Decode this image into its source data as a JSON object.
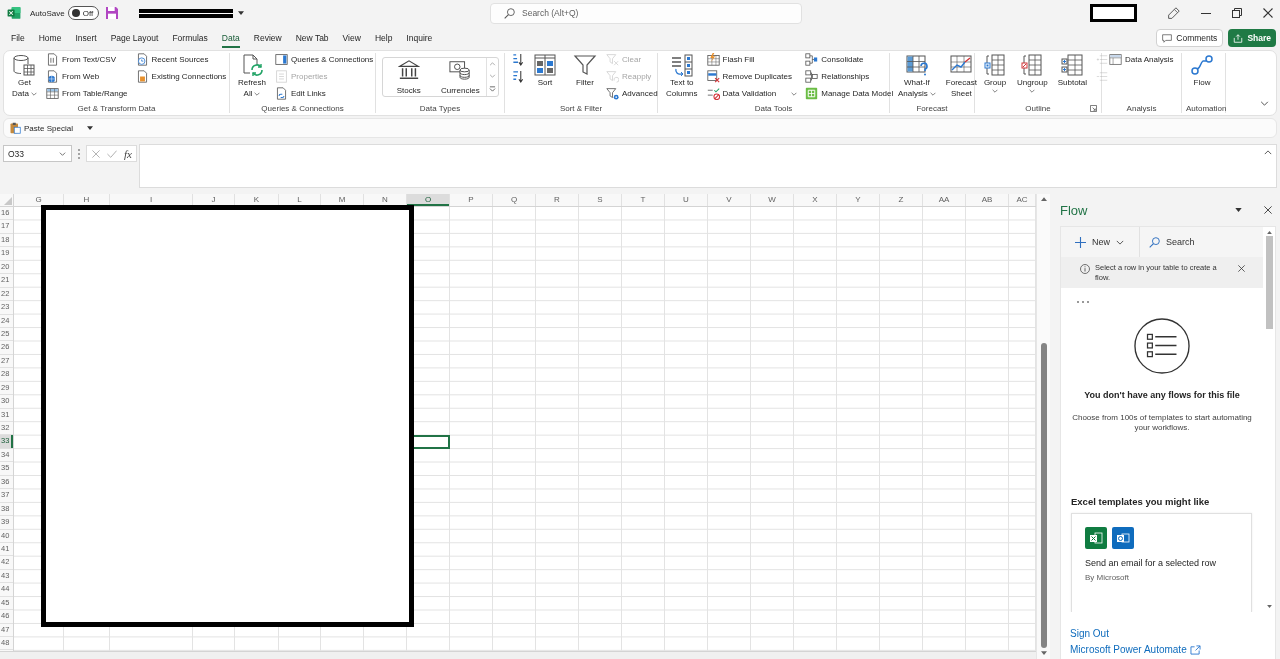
{
  "title_bar": {
    "autosave": {
      "label": "AutoSave",
      "on": false,
      "state": "Off"
    },
    "search": {
      "placeholder": "Search (Alt+Q)"
    }
  },
  "menu": {
    "tabs": [
      {
        "label": "File",
        "selected": false
      },
      {
        "label": "Home",
        "selected": false
      },
      {
        "label": "Insert",
        "selected": false
      },
      {
        "label": "Page Layout",
        "selected": false
      },
      {
        "label": "Formulas",
        "selected": false
      },
      {
        "label": "Data",
        "selected": true
      },
      {
        "label": "Review",
        "selected": false
      },
      {
        "label": "New Tab",
        "selected": false
      },
      {
        "label": "View",
        "selected": false
      },
      {
        "label": "Help",
        "selected": false
      },
      {
        "label": "Inquire",
        "selected": false
      }
    ],
    "buttons": [
      {
        "kind": "comments",
        "label": "Comments"
      },
      {
        "kind": "share",
        "label": "Share"
      }
    ]
  },
  "ribbon": {
    "groups": [
      {
        "label": "Get & Transform Data",
        "launcher": false,
        "controls": [
          {
            "kind": "large",
            "lines": [
              "Get",
              "Data"
            ],
            "dropdown": true,
            "disabled": false
          },
          {
            "kind": "small",
            "label": "From Text/CSV",
            "dropdown": false,
            "disabled": false
          },
          {
            "kind": "small",
            "label": "From Web",
            "dropdown": false,
            "disabled": false
          },
          {
            "kind": "small",
            "label": "From Table/Range",
            "dropdown": false,
            "disabled": false
          },
          {
            "kind": "small",
            "label": "Recent Sources",
            "dropdown": false,
            "disabled": false
          },
          {
            "kind": "small",
            "label": "Existing Connections",
            "dropdown": false,
            "disabled": false
          }
        ]
      },
      {
        "label": "Queries & Connections",
        "launcher": false,
        "controls": [
          {
            "kind": "large",
            "lines": [
              "Refresh",
              "All"
            ],
            "dropdown": true,
            "disabled": false
          },
          {
            "kind": "small",
            "label": "Queries & Connections",
            "dropdown": false,
            "disabled": false
          },
          {
            "kind": "small",
            "label": "Properties",
            "dropdown": false,
            "disabled": true
          },
          {
            "kind": "small",
            "label": "Edit Links",
            "dropdown": false,
            "disabled": false
          }
        ]
      },
      {
        "label": "Data Types",
        "launcher": false,
        "controls": [
          {
            "kind": "gallery",
            "options": [
              {
                "label": "Stocks"
              },
              {
                "label": "Currencies"
              }
            ],
            "dropdown": true,
            "disabled": false
          }
        ]
      },
      {
        "label": "Sort & Filter",
        "launcher": false,
        "controls": [
          {
            "kind": "icon",
            "dropdown": false,
            "disabled": false
          },
          {
            "kind": "icon",
            "dropdown": false,
            "disabled": false
          },
          {
            "kind": "large",
            "lines": [
              "Sort"
            ],
            "dropdown": false,
            "disabled": false
          },
          {
            "kind": "divider"
          },
          {
            "kind": "large",
            "lines": [
              "Filter"
            ],
            "dropdown": false,
            "disabled": false
          },
          {
            "kind": "small",
            "label": "Clear",
            "dropdown": false,
            "disabled": true
          },
          {
            "kind": "small",
            "label": "Reapply",
            "dropdown": false,
            "disabled": true
          },
          {
            "kind": "small",
            "label": "Advanced",
            "dropdown": false,
            "disabled": false
          }
        ]
      },
      {
        "label": "Data Tools",
        "launcher": false,
        "controls": [
          {
            "kind": "large",
            "lines": [
              "Text to",
              "Columns"
            ],
            "dropdown": false,
            "disabled": false
          },
          {
            "kind": "small",
            "label": "Flash Fill",
            "dropdown": false,
            "disabled": false
          },
          {
            "kind": "small",
            "label": "Remove Duplicates",
            "dropdown": false,
            "disabled": false
          },
          {
            "kind": "small",
            "label": "Data Validation",
            "dropdown": true,
            "disabled": false
          },
          {
            "kind": "small",
            "label": "Consolidate",
            "dropdown": false,
            "disabled": false
          },
          {
            "kind": "small",
            "label": "Relationships",
            "dropdown": false,
            "disabled": false
          },
          {
            "kind": "small",
            "label": "Manage Data Model",
            "dropdown": false,
            "disabled": false
          }
        ]
      },
      {
        "label": "Forecast",
        "launcher": false,
        "controls": [
          {
            "kind": "large",
            "lines": [
              "What-If",
              "Analysis"
            ],
            "dropdown": true,
            "disabled": false
          },
          {
            "kind": "large",
            "lines": [
              "Forecast",
              "Sheet"
            ],
            "dropdown": false,
            "disabled": false
          }
        ]
      },
      {
        "label": "Outline",
        "launcher": true,
        "controls": [
          {
            "kind": "large",
            "lines": [
              "Group"
            ],
            "dropdown": true,
            "disabled": false
          },
          {
            "kind": "large",
            "lines": [
              "Ungroup"
            ],
            "dropdown": true,
            "disabled": false
          },
          {
            "kind": "large",
            "lines": [
              "Subtotal"
            ],
            "dropdown": false,
            "disabled": false
          },
          {
            "kind": "icon",
            "dropdown": false,
            "disabled": true
          },
          {
            "kind": "icon",
            "dropdown": false,
            "disabled": true
          }
        ]
      },
      {
        "label": "Analysis",
        "launcher": false,
        "controls": [
          {
            "kind": "small",
            "label": "Data Analysis",
            "dropdown": false,
            "disabled": false
          }
        ]
      },
      {
        "label": "Automation",
        "launcher": false,
        "controls": [
          {
            "kind": "large",
            "lines": [
              "Flow"
            ],
            "dropdown": false,
            "disabled": false
          }
        ]
      }
    ]
  },
  "quick_access": {
    "items": [
      {
        "label": "Paste Special"
      }
    ]
  },
  "formula_bar": {
    "name_box": "O33",
    "function_label": "fx"
  },
  "sheet": {
    "columns": [
      {
        "label": "G",
        "selected": false
      },
      {
        "label": "H",
        "selected": false
      },
      {
        "label": "I",
        "selected": false
      },
      {
        "label": "J",
        "selected": false
      },
      {
        "label": "K",
        "selected": false
      },
      {
        "label": "L",
        "selected": false
      },
      {
        "label": "M",
        "selected": false
      },
      {
        "label": "N",
        "selected": false
      },
      {
        "label": "O",
        "selected": true
      },
      {
        "label": "P",
        "selected": false
      },
      {
        "label": "Q",
        "selected": false
      },
      {
        "label": "R",
        "selected": false
      },
      {
        "label": "S",
        "selected": false
      },
      {
        "label": "T",
        "selected": false
      },
      {
        "label": "U",
        "selected": false
      },
      {
        "label": "V",
        "selected": false
      },
      {
        "label": "W",
        "selected": false
      },
      {
        "label": "X",
        "selected": false
      },
      {
        "label": "Y",
        "selected": false
      },
      {
        "label": "Z",
        "selected": false
      },
      {
        "label": "AA",
        "selected": false
      },
      {
        "label": "AB",
        "selected": false
      },
      {
        "label": "AC",
        "selected": false
      }
    ],
    "rows": [
      {
        "label": "16",
        "selected": false
      },
      {
        "label": "17",
        "selected": false
      },
      {
        "label": "18",
        "selected": false
      },
      {
        "label": "19",
        "selected": false
      },
      {
        "label": "20",
        "selected": false
      },
      {
        "label": "21",
        "selected": false
      },
      {
        "label": "22",
        "selected": false
      },
      {
        "label": "23",
        "selected": false
      },
      {
        "label": "24",
        "selected": false
      },
      {
        "label": "25",
        "selected": false
      },
      {
        "label": "26",
        "selected": false
      },
      {
        "label": "27",
        "selected": false
      },
      {
        "label": "28",
        "selected": false
      },
      {
        "label": "29",
        "selected": false
      },
      {
        "label": "30",
        "selected": false
      },
      {
        "label": "31",
        "selected": false
      },
      {
        "label": "32",
        "selected": false
      },
      {
        "label": "33",
        "selected": true
      },
      {
        "label": "34",
        "selected": false
      },
      {
        "label": "35",
        "selected": false
      },
      {
        "label": "36",
        "selected": false
      },
      {
        "label": "37",
        "selected": false
      },
      {
        "label": "38",
        "selected": false
      },
      {
        "label": "39",
        "selected": false
      },
      {
        "label": "40",
        "selected": false
      },
      {
        "label": "41",
        "selected": false
      },
      {
        "label": "42",
        "selected": false
      },
      {
        "label": "43",
        "selected": false
      },
      {
        "label": "44",
        "selected": false
      },
      {
        "label": "45",
        "selected": false
      },
      {
        "label": "46",
        "selected": false
      },
      {
        "label": "47",
        "selected": false
      },
      {
        "label": "48",
        "selected": false
      }
    ]
  },
  "flow_pane": {
    "title": "Flow",
    "toolbar": [
      {
        "kind": "new",
        "label": "New"
      },
      {
        "kind": "search",
        "label": "Search"
      }
    ],
    "notice": "Select a row in your table to create a flow.",
    "empty_state": {
      "title": "You don't have any flows for this file",
      "text": "Choose from 100s of templates to start automating your workflows."
    },
    "templates": {
      "heading": "Excel templates you might like",
      "items": [
        {
          "title": "Send an email for a selected row",
          "author": "By Microsoft"
        }
      ]
    },
    "links": [
      {
        "kind": "plain",
        "label": "Sign Out"
      },
      {
        "kind": "external",
        "label": "Microsoft Power Automate"
      }
    ]
  }
}
